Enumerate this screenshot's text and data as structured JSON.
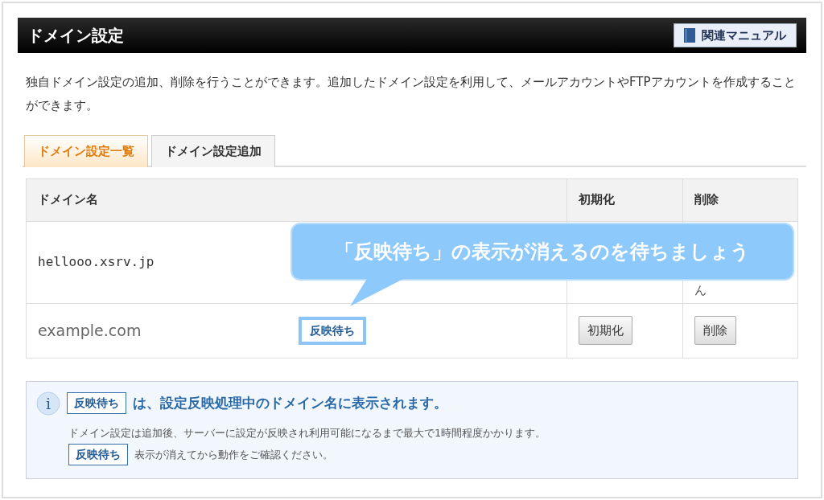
{
  "header": {
    "title": "ドメイン設定",
    "manual_button": "関連マニュアル"
  },
  "description": "独自ドメイン設定の追加、削除を行うことができます。追加したドメイン設定を利用して、メールアカウントやFTPアカウントを作成することができます。",
  "tabs": [
    {
      "label": "ドメイン設定一覧",
      "selected": true
    },
    {
      "label": "ドメイン設定追加",
      "selected": false
    }
  ],
  "table": {
    "columns": [
      "ドメイン名",
      "初期化",
      "削除"
    ],
    "rows": [
      {
        "kind": "obscured",
        "domain": "hellooo.xsrv.jp",
        "delete_text_fragment": "ん"
      },
      {
        "kind": "pending",
        "domain": "example.com",
        "status_badge": "反映待ち",
        "reset_button": "初期化",
        "delete_button": "削除"
      }
    ]
  },
  "callout": {
    "text": "「反映待ち」の表示が消えるのを待ちましょう"
  },
  "info": {
    "icon": "i",
    "badge": "反映待ち",
    "heading": "は、設定反映処理中のドメイン名に表示されます。",
    "note": "ドメイン設定は追加後、サーバーに設定が反映され利用可能になるまで最大で1時間程度かかります。",
    "badge_2": "反映待ち",
    "note_2": "表示が消えてから動作をご確認ください。"
  }
}
